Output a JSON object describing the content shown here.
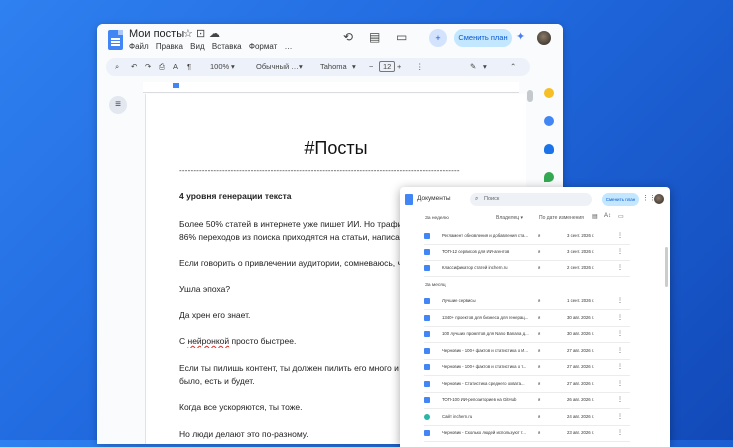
{
  "doc": {
    "title": "Мои посты",
    "title_icons": [
      "star-icon",
      "move-to-folder-icon",
      "cloud-status-icon"
    ],
    "menu": [
      "Файл",
      "Правка",
      "Вид",
      "Вставка",
      "Формат",
      "…"
    ],
    "share_button": "Сменить план",
    "toolbar": {
      "zoom": "100%",
      "style": "Обычный …",
      "font": "Tahoma",
      "minus": "−",
      "font_size": "12",
      "plus": "+"
    },
    "outline_icon": "≡",
    "heading": "#Посты",
    "dashes": "--------------------------------------------------------------------------------------------------",
    "paragraphs": {
      "p1": "4 уровня генерации текста",
      "p2a": "Более 50% статей в интернете уже пишет ИИ. Но трафик ",
      "p2link": "ид",
      "p2b": "86% переходов из поиска приходятся на статьи, написанны",
      "p3": "Если говорить о привлечении аудитории, сомневаюсь, что с",
      "p4": "Ушла эпоха?",
      "p5": "Да хрен его знает.",
      "p6a": "С ",
      "p6b": "нейронкой",
      "p6c": " просто быстрее.",
      "p7a": "Если ты пилишь контент, ты должен пилить его много и луч",
      "p7b": "было, есть и будет.",
      "p8": "Когда все ускоряются, ты тоже.",
      "p9": "Но люди делают это по-разному."
    }
  },
  "drive": {
    "app_title": "Документы",
    "search_placeholder": "Поиск",
    "plan_button": "Сменить план",
    "filter_owner": "Владелец ▾",
    "filter_sort": "По дате изменения",
    "section_week": "За неделю",
    "section_month": "За месяц",
    "rows_week": [
      {
        "name": "Регламент обновления и добавления ста...",
        "date": "3 сент. 2026 г."
      },
      {
        "name": "ТОП-12 сервисов для ИИ-агентов",
        "date": "3 сент. 2026 г."
      },
      {
        "name": "Классификатор статей inchern.ru",
        "date": "2 сент. 2026 г."
      }
    ],
    "rows_month": [
      {
        "name": "Лучшие сервисы",
        "date": "1 сент. 2026 г."
      },
      {
        "name": "1340+ проектов для бизнеса для генерац...",
        "date": "30 авг. 2026 г."
      },
      {
        "name": "100 лучших промптов для Nano Banana д...",
        "date": "30 авг. 2026 г."
      },
      {
        "name": "Черновик - 100+ фактов и статистика о И...",
        "date": "27 авг. 2026 г."
      },
      {
        "name": "Черновик - 100+ фактов и статистика о т...",
        "date": "27 авг. 2026 г."
      },
      {
        "name": "Черновик - Статистика среднего охвата...",
        "date": "27 авг. 2026 г."
      },
      {
        "name": "ТОП-100 ИИ-репозиториев на GitHub",
        "date": "26 авг. 2026 г."
      },
      {
        "name": "Сайт inchern.ru",
        "date": "24 авг. 2026 г."
      },
      {
        "name": "Черновик - Сколько людей используют т...",
        "date": "23 авг. 2026 г."
      }
    ],
    "owner_value": "я",
    "more_glyph": "⋮"
  }
}
